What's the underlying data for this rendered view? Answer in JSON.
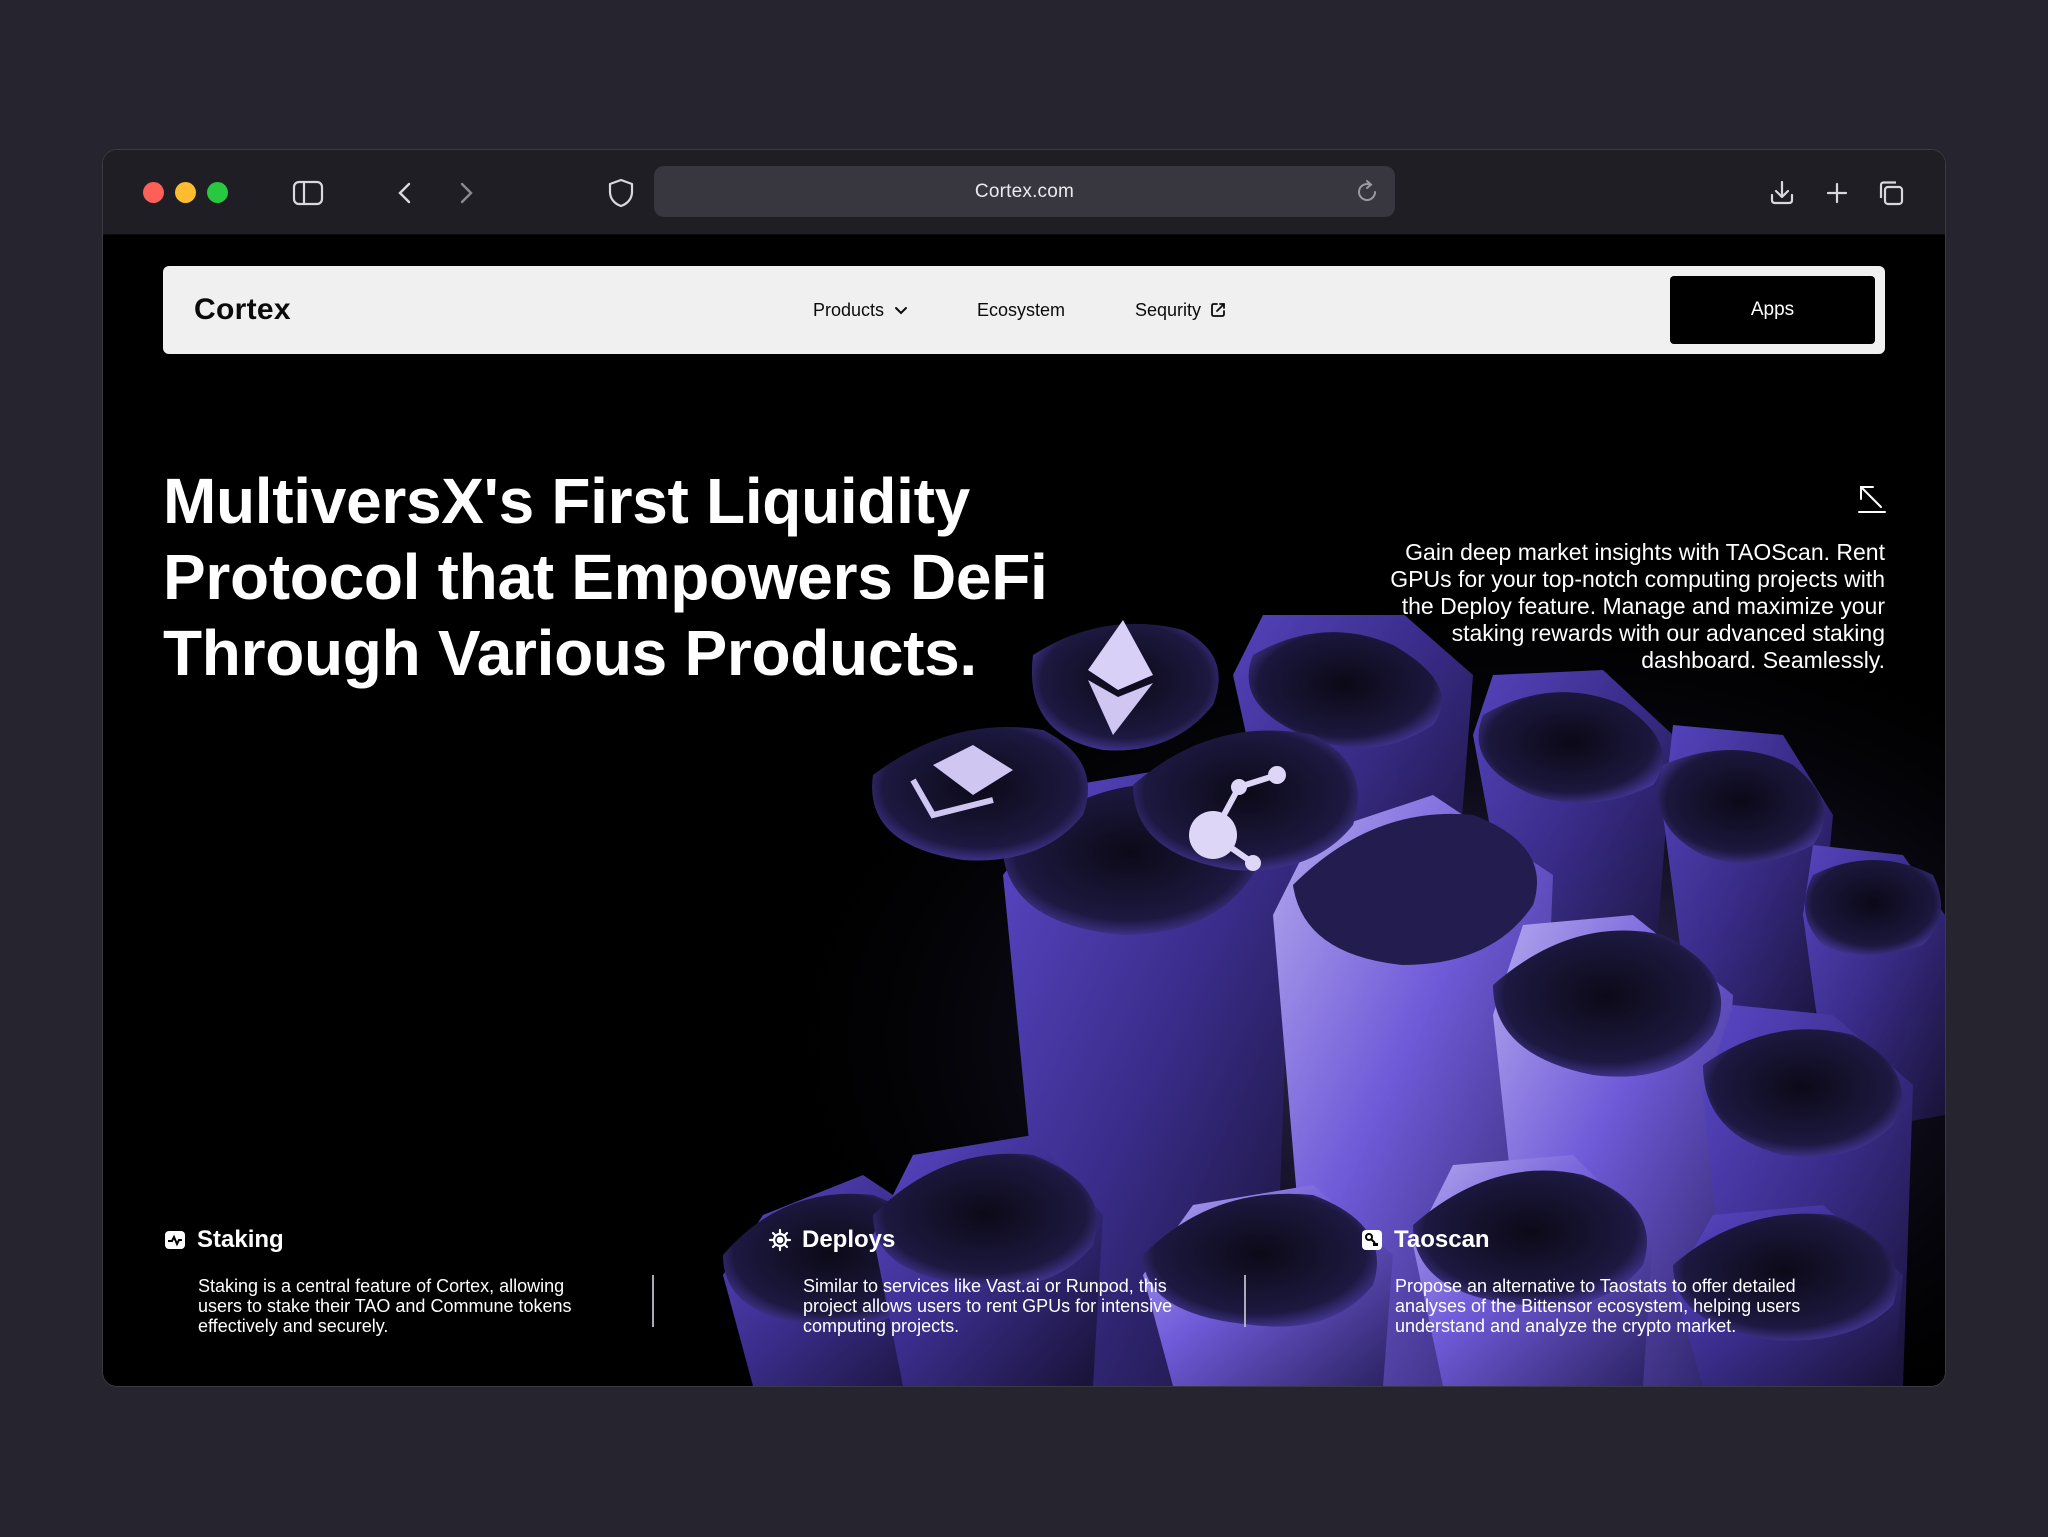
{
  "browser": {
    "url": "Cortex.com",
    "icons": [
      "sidebar-icon",
      "back-icon",
      "forward-icon",
      "shield-icon",
      "reload-icon",
      "download-icon",
      "new-tab-icon",
      "tabs-icon"
    ]
  },
  "nav": {
    "logo": "Cortex",
    "items": [
      {
        "label": "Products",
        "icon": "chevron-down-icon"
      },
      {
        "label": "Ecosystem"
      },
      {
        "label": "Sequrity",
        "icon": "external-link-icon"
      }
    ],
    "cta": "Apps"
  },
  "hero": {
    "title_lines": [
      "MultiversX's First Liquidity",
      "Protocol that Empowers DeFi",
      "Through Various Products."
    ],
    "description": "Gain deep market insights with TAOScan. Rent GPUs for your top-notch computing projects with the Deploy feature. Manage and maximize your staking rewards with our advanced staking dashboard. Seamlessly.",
    "arrow_icon": "arrow-up-left-icon"
  },
  "features": [
    {
      "title": "Staking",
      "icon": "staking-icon",
      "description": "Staking is a central feature of Cortex, allowing users to stake their TAO and Commune tokens effectively and securely."
    },
    {
      "title": "Deploys",
      "icon": "gear-icon",
      "description": "Similar to services like Vast.ai or Runpod, this project allows users to rent GPUs for intensive computing projects."
    },
    {
      "title": "Taoscan",
      "icon": "taoscan-icon",
      "description": "Propose an alternative to Taostats to offer detailed analyses of the Bittensor ecosystem, helping users understand and analyze the crypto market."
    }
  ],
  "colors": {
    "page_bg": "#25242f",
    "chrome_bg": "#1f1e25",
    "nav_bg": "#f0f0f0",
    "accent_purple": "#6b55d8"
  }
}
